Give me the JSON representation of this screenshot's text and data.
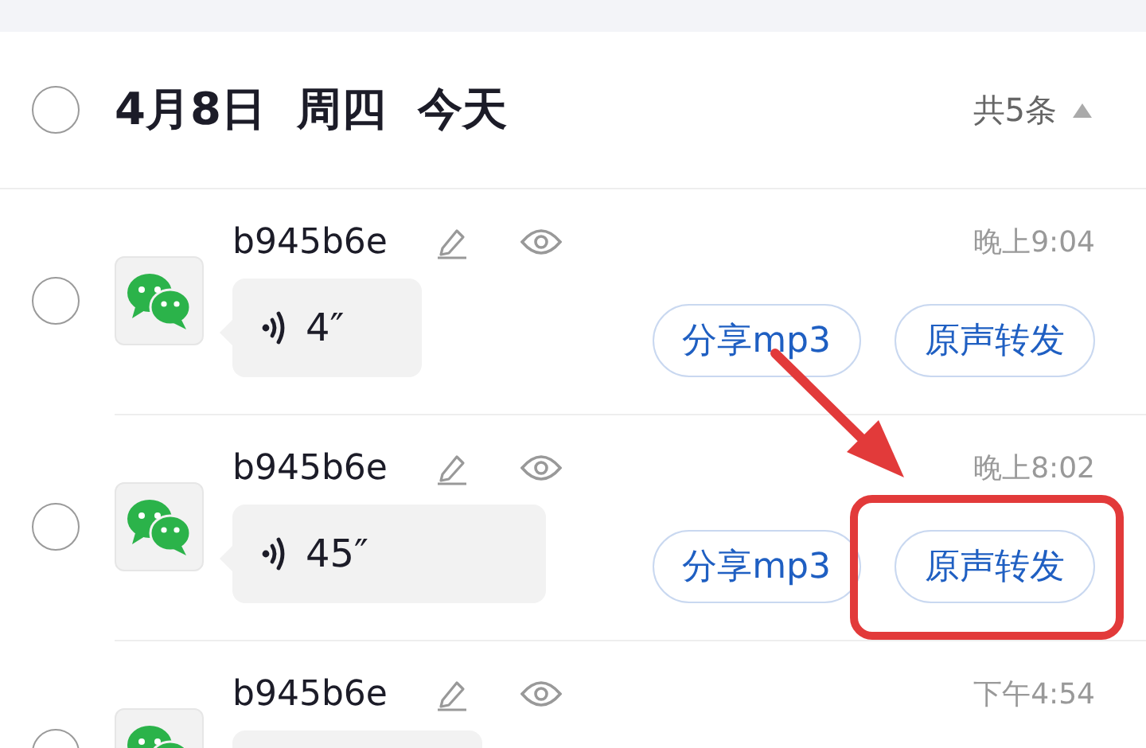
{
  "day_header": {
    "checked": false,
    "date": "4月8日",
    "weekday": "周四",
    "relative": "今天",
    "count": "共5条",
    "expanded": true
  },
  "messages": [
    {
      "checked": false,
      "sender": "b945b6e",
      "time": "晚上9:04",
      "duration": "4″",
      "buttons": [
        "分享mp3",
        "原声转发"
      ]
    },
    {
      "checked": false,
      "sender": "b945b6e",
      "time": "晚上8:02",
      "duration": "45″",
      "buttons": [
        "分享mp3",
        "原声转发"
      ]
    },
    {
      "checked": false,
      "sender": "b945b6e",
      "time": "下午4:54"
    }
  ],
  "annotation": {
    "arrow": true,
    "highlight_box": true
  }
}
